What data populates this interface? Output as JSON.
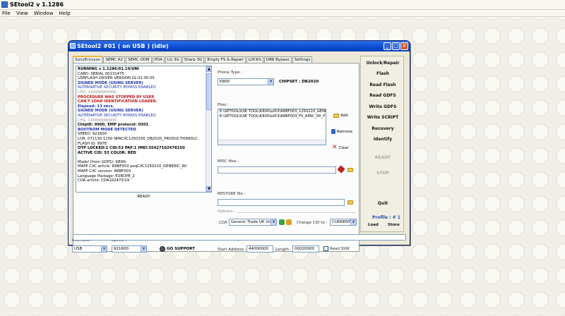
{
  "app": {
    "title": "SEtool2 v 1.1286",
    "menu": [
      "File",
      "View",
      "Window",
      "Help"
    ]
  },
  "window": {
    "title": "SEtool2 #01 ( on USB ) (idle)",
    "controls": [
      "_",
      "□",
      "✕"
    ]
  },
  "tabs": [
    "SonyEricsson",
    "SEMC A2",
    "SEMC ODM",
    "PDA",
    "LG 3G",
    "Sharp 3G",
    "Empty FS & Repair",
    "LOCKS",
    "DB8 Bypass",
    "Settings"
  ],
  "log": {
    "lines": [
      {
        "text": "RUNNING v 1.1286/01.14/UNI",
        "color": "#000"
      },
      {
        "text": "CARD: SERIAL 00131475",
        "color": "#000"
      },
      {
        "text": "USBFLASH DRIVER VERSION 02.02.00.05",
        "color": "#000"
      },
      {
        "text": "SIGNED MODE (USING SERVER)",
        "color": "#1a2fb0"
      },
      {
        "text": "ALTERNATIVE SECURITY BYPASS ENABLED",
        "color": "#1a2fb0"
      },
      {
        "text": "CFG: 110000000000",
        "color": "#888"
      },
      {
        "text": "PROCEDURE WAS STOPPED BY USER",
        "color": "#c01010"
      },
      {
        "text": "CAN'T LOAD IDENTIFICATION LOADER.",
        "color": "#c01010"
      },
      {
        "text": "Elapsed: 13 secs.",
        "color": "#1a2fb0"
      },
      {
        "text": "SIGNED MODE (USING SERVER)",
        "color": "#1a2fb0"
      },
      {
        "text": "ALTERNATIVE SECURITY BYPASS ENABLED",
        "color": "#1a2fb0"
      },
      {
        "text": "CFG: 110000000000",
        "color": "#888"
      },
      {
        "text": "ChipID: 9900, EMP protocol: 0301",
        "color": "#000"
      },
      {
        "text": "BOOTROM MODE DETECTED",
        "color": "#1a2fb0"
      },
      {
        "text": "SPEED: 921600",
        "color": "#000"
      },
      {
        "text": "LDR: 071130 1150 NPACXC1250330_DB2020_PRODUCTIONIDLC",
        "color": "#000"
      },
      {
        "text": "FLASH ID: 897E",
        "color": "#000"
      },
      {
        "text": "OTP LOCKED:1 CID:53 PAF:1 IMEI:35427102478150",
        "color": "#000"
      },
      {
        "text": "ACTIVE CID: 53 COLOR: RED",
        "color": "#000"
      },
      {
        "text": "",
        "color": "#000"
      },
      {
        "text": "Model (from GDFS): K800i",
        "color": "#000"
      },
      {
        "text": "MAPP CXC article: R8BF003     peqCXC1250210_GENERIC_WI",
        "color": "#000"
      },
      {
        "text": "MAPP CXC version: R8BF003",
        "color": "#000"
      },
      {
        "text": "Language Package: EUROPE_2",
        "color": "#000"
      },
      {
        "text": "CDA article: CDA102475/19",
        "color": "#000"
      }
    ],
    "status": "READY"
  },
  "interface": {
    "label": "Interface :",
    "value": "USB"
  },
  "speed": {
    "label": "Speed :",
    "value": "921600"
  },
  "go_support": "GO SUPPORT",
  "phone": {
    "type_label": "Phone Type :",
    "type_value": "K800",
    "chipset": "CHIPSET : DB2020"
  },
  "files": {
    "label": "Files :",
    "items": [
      "E:\\SETOOLS\\SE TOOL\\K800\\sd53\\R8BF003_1250210_GENE",
      "E:\\SETOOLS\\SE TOOL\\K800\\sd53\\R8BF003_FS_APAC_WI_P"
    ],
    "add": "Add",
    "remove": "Remove",
    "clear": "Clear"
  },
  "misc": {
    "label": "MISC files :",
    "value": ""
  },
  "restore": {
    "label": "RESTORE file :",
    "value": ""
  },
  "options": {
    "label": "Options :",
    "cda_label": "CDA :",
    "cda_value": "Generic Trade UK Un",
    "change_cid_label": "Change CID to :",
    "change_cid_value": "CURRENT"
  },
  "read_setup": {
    "label": "Read Setup",
    "start_label": "Start Address :",
    "start_value": "44000000",
    "length_label": "Length :",
    "length_value": "00020000",
    "read_ssw": "Read SSW"
  },
  "actions": [
    {
      "label": "Unlock/Repair",
      "enabled": true
    },
    {
      "label": "Flash",
      "enabled": true
    },
    {
      "label": "Read Flash",
      "enabled": true
    },
    {
      "label": "Read GDFS",
      "enabled": true
    },
    {
      "label": "Write GDFS",
      "enabled": true
    },
    {
      "label": "Write SCRIPT",
      "enabled": true
    },
    {
      "label": "Recovery",
      "enabled": true
    },
    {
      "label": "Identify",
      "enabled": true
    },
    {
      "label": "READY",
      "enabled": false
    },
    {
      "label": "STOP",
      "enabled": false
    },
    {
      "label": "Quit",
      "enabled": true
    }
  ],
  "profile": {
    "label": "Profile : # 1",
    "load": "Load",
    "store": "Store"
  },
  "colors": {
    "titlebar": "#0a4bd1",
    "close": "#d8552d",
    "tab_accent": "#f6b33b"
  }
}
